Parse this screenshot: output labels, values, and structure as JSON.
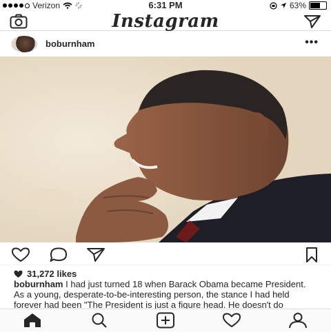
{
  "status_bar": {
    "signal_bars_filled": 4,
    "signal_bars_total": 5,
    "carrier": "Verizon",
    "time": "6:31 PM",
    "battery_percent": "63%",
    "battery_level": 0.63
  },
  "header": {
    "logo": "Instagram"
  },
  "post": {
    "username": "boburnham",
    "more_label": "•••",
    "likes": "31,272 likes",
    "caption_user": "boburnham",
    "caption_text": "I had just turned 18 when Barack Obama became President. As a young, desperate-to-be-interesting person, the stance I had held forever had been \"The President is just a figure head. He doesn't do"
  },
  "icons": {
    "camera": "camera-icon",
    "direct": "paper-plane-icon",
    "like": "heart-icon",
    "comment": "comment-bubble-icon",
    "share": "paper-plane-icon",
    "save": "bookmark-icon",
    "home": "home-icon",
    "search": "search-icon",
    "add": "plus-square-icon",
    "activity": "heart-icon",
    "profile": "person-icon"
  },
  "colors": {
    "text": "#262626",
    "border": "#dbdbdb",
    "nav_bg": "#fafafa"
  }
}
